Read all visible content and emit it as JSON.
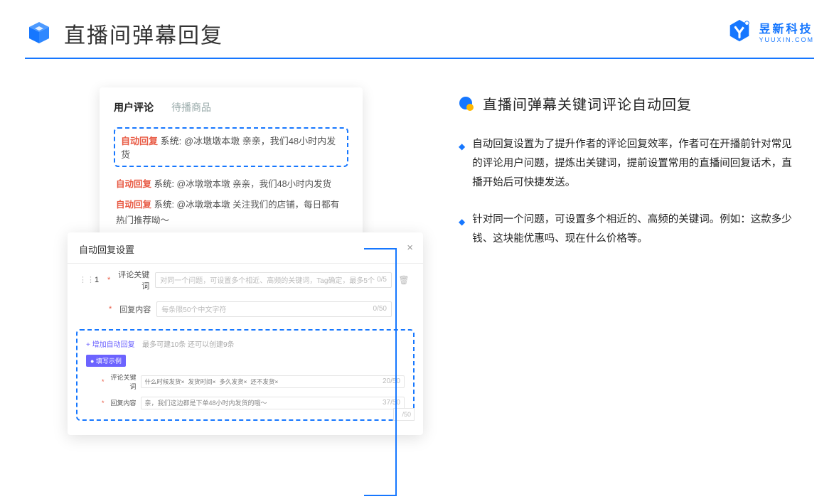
{
  "header": {
    "title": "直播间弹幕回复"
  },
  "brand": {
    "name": "昱新科技",
    "url": "YUUXIN.COM"
  },
  "card_top": {
    "tab_active": "用户评论",
    "tab_inactive": "待播商品",
    "highlight_auto": "自动回复",
    "highlight_sys": "系统:",
    "highlight_msg": "@冰墩墩本墩 亲亲，我们48小时内发货",
    "line2_auto": "自动回复",
    "line2_sys": "系统:",
    "line2_msg": "@冰墩墩本墩 亲亲，我们48小时内发货",
    "line3_auto": "自动回复",
    "line3_sys": "系统:",
    "line3_msg": "@冰墩墩本墩 关注我们的店铺，每日都有热门推荐呦～"
  },
  "card_bottom": {
    "title": "自动回复设置",
    "row_num": "1",
    "label_keyword": "评论关键词",
    "placeholder_keyword": "对同一个问题，可设置多个相近、高频的关键词，Tag确定，最多5个",
    "counter_keyword": "0/5",
    "label_content": "回复内容",
    "placeholder_content": "每条限50个中文字符",
    "counter_content": "0/50",
    "add_text": "+ 增加自动回复",
    "add_hint": "最多可建10条 还可以创建9条",
    "example_badge": "● 填写示例",
    "ex_label_keyword": "评论关键词",
    "ex_tag1": "什么时候发货×",
    "ex_tag2": "发货时间×",
    "ex_tag3": "多久发货×",
    "ex_tag4": "还不发货×",
    "ex_counter1": "20/50",
    "ex_label_content": "回复内容",
    "ex_content_val": "亲，我们这边都是下单48小时内发货的哦～",
    "ex_counter2": "37/50",
    "half_counter": "/50"
  },
  "right": {
    "title": "直播间弹幕关键词评论自动回复",
    "bullet1": "自动回复设置为了提升作者的评论回复效率，作者可在开播前针对常见的评论用户问题，提炼出关键词，提前设置常用的直播间回复话术，直播开始后可快捷发送。",
    "bullet2": "针对同一个问题，可设置多个相近的、高频的关键词。例如：这款多少钱、这块能优惠吗、现在什么价格等。"
  }
}
